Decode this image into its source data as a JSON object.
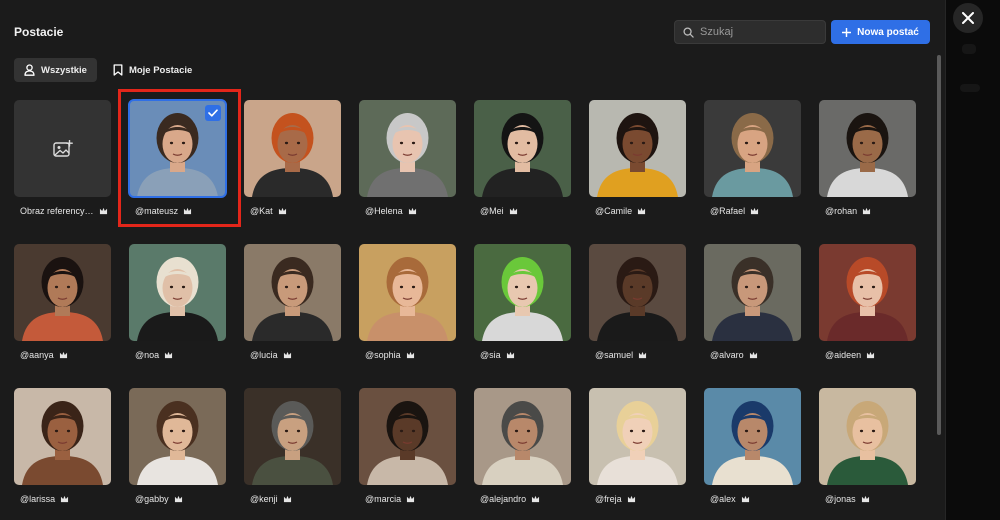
{
  "panel": {
    "title": "Postacie",
    "close_icon": "close-icon"
  },
  "search": {
    "placeholder": "Szukaj",
    "icon": "search-icon"
  },
  "new_button": {
    "label": "Nowa postać",
    "icon": "plus-icon"
  },
  "tabs": [
    {
      "label": "Wszystkie",
      "icon": "person-icon",
      "active": true
    },
    {
      "label": "Moje Postacie",
      "icon": "bookmark-icon",
      "active": false
    }
  ],
  "reference": {
    "label": "Obraz referency…",
    "icon": "add-image-icon"
  },
  "characters": [
    {
      "name": "@mateusz",
      "selected": true,
      "bg": "#6a8db8",
      "skin": "#d9a88a",
      "hair": "#3a2a20",
      "shirt": "#8aa0b8"
    },
    {
      "name": "@Kat",
      "selected": false,
      "bg": "#c9a58a",
      "skin": "#a86a48",
      "hair": "#c4521e",
      "shirt": "#2a2a2a"
    },
    {
      "name": "@Helena",
      "selected": false,
      "bg": "#5d6a58",
      "skin": "#e8c4b0",
      "hair": "#c8c8c8",
      "shirt": "#707070"
    },
    {
      "name": "@Mei",
      "selected": false,
      "bg": "#4a6048",
      "skin": "#e2bca2",
      "hair": "#141414",
      "shirt": "#222"
    },
    {
      "name": "@Camile",
      "selected": false,
      "bg": "#b8b8b0",
      "skin": "#7a4a30",
      "hair": "#1e1410",
      "shirt": "#e0a020"
    },
    {
      "name": "@Rafael",
      "selected": false,
      "bg": "#3a3a3a",
      "skin": "#d8a482",
      "hair": "#8a6a48",
      "shirt": "#6a9aa0"
    },
    {
      "name": "@rohan",
      "selected": false,
      "bg": "#6a6a68",
      "skin": "#9a6a48",
      "hair": "#1a1410",
      "shirt": "#d8d8d8"
    },
    {
      "name": "@aanya",
      "selected": false,
      "bg": "#4a3a30",
      "skin": "#b07a58",
      "hair": "#1a1210",
      "shirt": "#c45a3a"
    },
    {
      "name": "@noa",
      "selected": false,
      "bg": "#5a7a6a",
      "skin": "#e0c0a8",
      "hair": "#e8e0d0",
      "shirt": "#1a1a1a"
    },
    {
      "name": "@lucia",
      "selected": false,
      "bg": "#8a7a68",
      "skin": "#c89a7a",
      "hair": "#3a2a20",
      "shirt": "#2a2a2a"
    },
    {
      "name": "@sophia",
      "selected": false,
      "bg": "#c8a060",
      "skin": "#e8b898",
      "hair": "#a86a3a",
      "shirt": "#c8906a"
    },
    {
      "name": "@sia",
      "selected": false,
      "bg": "#4a6a40",
      "skin": "#e8c8b0",
      "hair": "#6ac83a",
      "shirt": "#d8d8d8"
    },
    {
      "name": "@samuel",
      "selected": false,
      "bg": "#5a4a40",
      "skin": "#5a3a28",
      "hair": "#2a1a14",
      "shirt": "#1a1a1a"
    },
    {
      "name": "@alvaro",
      "selected": false,
      "bg": "#6a6a60",
      "skin": "#c8987a",
      "hair": "#3a3028",
      "shirt": "#2a3040"
    },
    {
      "name": "@aideen",
      "selected": false,
      "bg": "#7a3a30",
      "skin": "#e8c0a8",
      "hair": "#b84a28",
      "shirt": "#6a2a2a"
    },
    {
      "name": "@larissa",
      "selected": false,
      "bg": "#c8b8a8",
      "skin": "#9a6040",
      "hair": "#3a2418",
      "shirt": "#7a4a30"
    },
    {
      "name": "@gabby",
      "selected": false,
      "bg": "#7a6a58",
      "skin": "#e0b898",
      "hair": "#4a3020",
      "shirt": "#e8e4e0"
    },
    {
      "name": "@kenji",
      "selected": false,
      "bg": "#3a3028",
      "skin": "#c8a080",
      "hair": "#5a5a58",
      "shirt": "#4a5040"
    },
    {
      "name": "@marcia",
      "selected": false,
      "bg": "#6a5040",
      "skin": "#5a3a28",
      "hair": "#1a1410",
      "shirt": "#c8b8a8"
    },
    {
      "name": "@alejandro",
      "selected": false,
      "bg": "#a89888",
      "skin": "#b8886a",
      "hair": "#4a4a48",
      "shirt": "#d8d0c0"
    },
    {
      "name": "@freja",
      "selected": false,
      "bg": "#c8c0b0",
      "skin": "#f0d0b8",
      "hair": "#e8d098",
      "shirt": "#e8e0d8"
    },
    {
      "name": "@alex",
      "selected": false,
      "bg": "#5a8aa8",
      "skin": "#b8886a",
      "hair": "#1a3a6a",
      "shirt": "#e8e0d0"
    },
    {
      "name": "@jonas",
      "selected": false,
      "bg": "#c8b8a0",
      "skin": "#e8c0a0",
      "hair": "#c8a878",
      "shirt": "#2a5a3a"
    }
  ],
  "crown_icon": "crown-icon",
  "check_icon": "check-icon"
}
